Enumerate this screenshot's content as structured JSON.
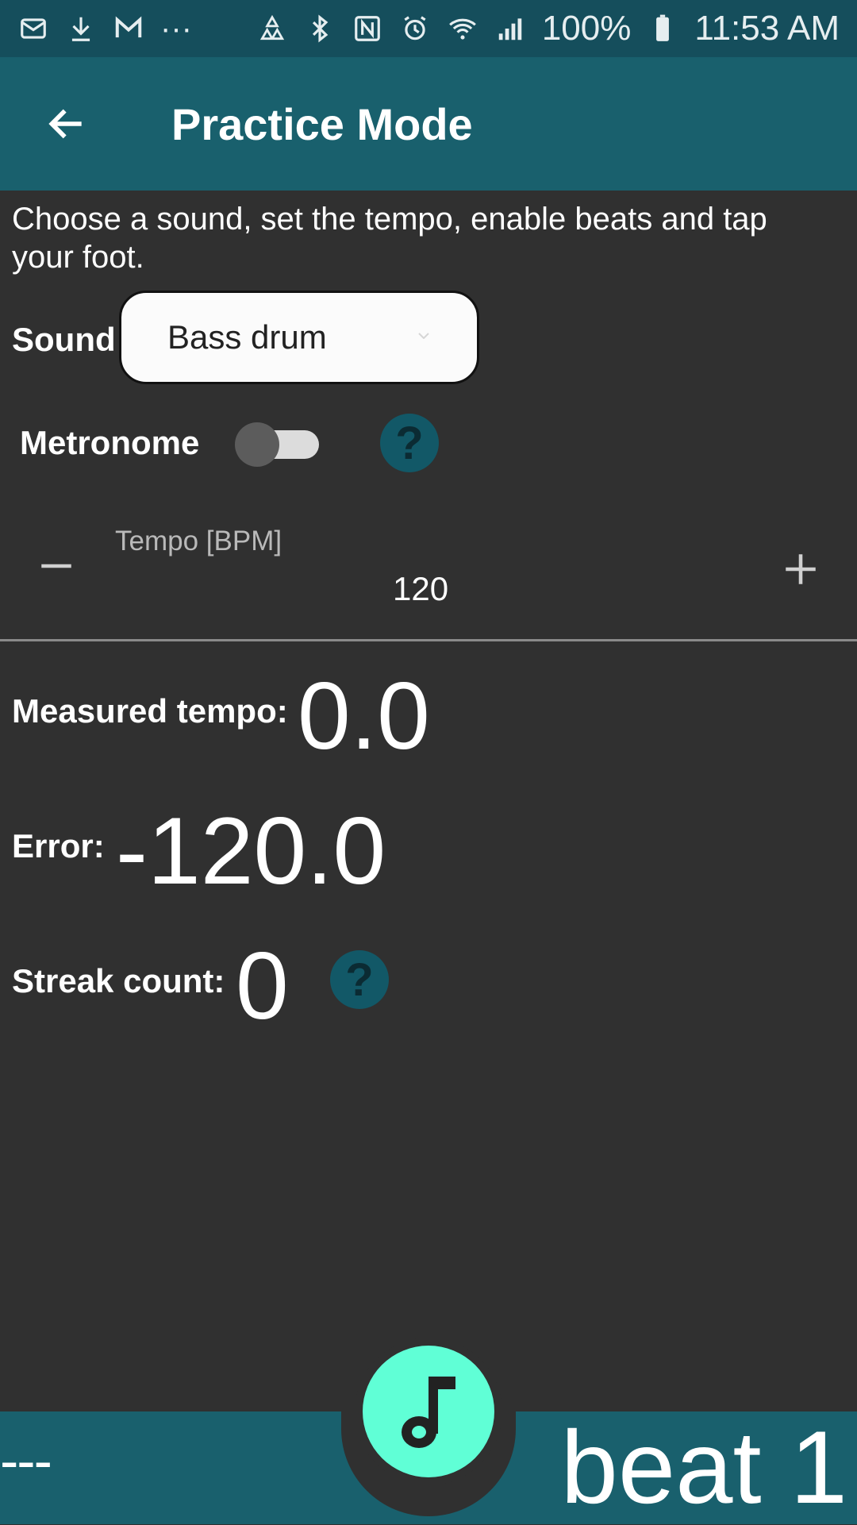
{
  "status_bar": {
    "left_icons": [
      "mail-icon",
      "download-icon",
      "gmail-icon",
      "more-dots-icon"
    ],
    "more_dots": "···",
    "right_icons": [
      "recycle-icon",
      "bluetooth-icon",
      "nfc-icon",
      "alarm-icon",
      "wifi-icon",
      "signal-icon",
      "battery-icon"
    ],
    "battery": "100%",
    "time": "11:53 AM"
  },
  "app_bar": {
    "title": "Practice Mode",
    "back_icon": "arrow-left-icon"
  },
  "intro_text": "Choose a sound, set the tempo, enable beats and tap your foot.",
  "sound": {
    "label": "Sound",
    "selected": "Bass drum"
  },
  "metronome": {
    "label": "Metronome",
    "enabled": false,
    "help_symbol": "?"
  },
  "tempo": {
    "label": "Tempo [BPM]",
    "value": "120",
    "decrement_icon": "minus-icon",
    "increment_icon": "plus-icon"
  },
  "stats": {
    "measured_label": "Measured tempo:",
    "measured_value": "0.0",
    "error_label": "Error:",
    "error_value": "-120.0",
    "streak_label": "Streak count:",
    "streak_value": "0",
    "streak_help_symbol": "?"
  },
  "bottom_bar": {
    "left_text": "---",
    "beat_text": "beat 1",
    "fab_icon": "music-note-icon"
  },
  "colors": {
    "status_bar": "#154e5c",
    "app_bar": "#19606d",
    "background": "#303030",
    "accent": "#60ffd6",
    "help_button": "#125867"
  }
}
